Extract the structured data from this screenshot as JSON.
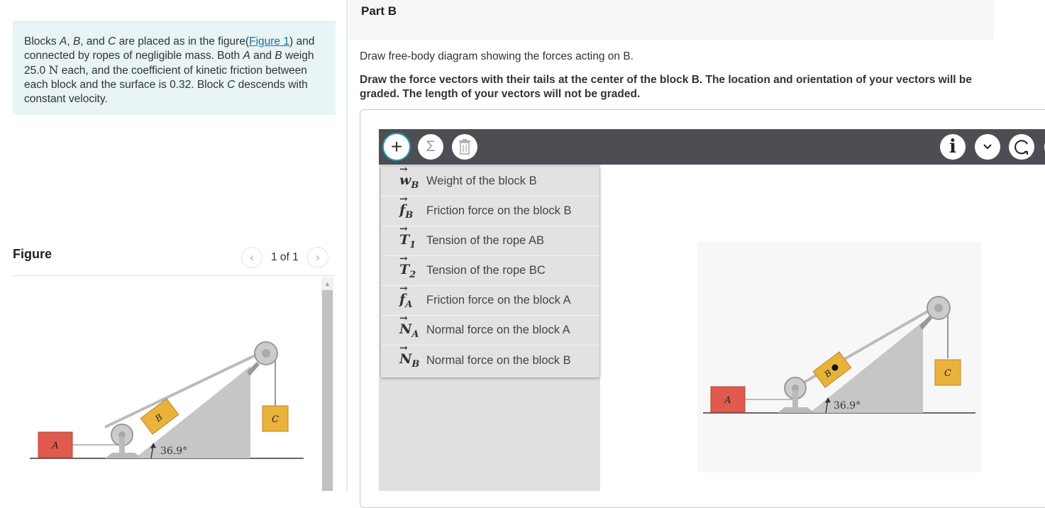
{
  "problem": {
    "text_before_link": "Blocks ",
    "A": "A",
    "comma1": ", ",
    "B": "B",
    "and": ", and ",
    "C": "C",
    "placed": " are placed as in the figure(",
    "link": "Figure 1",
    "after_link": ") and connected by ropes of negligible mass. Both ",
    "A2": "A",
    "and2": " and ",
    "B2": "B",
    "weigh": " weigh 25.0 ",
    "unitN": "N",
    "rest": " each, and the coefficient of kinetic friction between each block and the surface is 0.32. Block ",
    "C2": "C",
    "end": " descends with constant velocity."
  },
  "figure": {
    "title": "Figure",
    "pager_text": "1 of 1",
    "angle_label": "36.9°",
    "block_a": "A",
    "block_b": "B",
    "block_c": "C"
  },
  "part": {
    "title": "Part B",
    "instruction": "Draw free-body diagram showing the forces acting on B.",
    "instruction_bold": "Draw the force vectors with their tails at the center of the block B. The location and orientation of your vectors will be graded. The length of your vectors will not be graded."
  },
  "toolbar": {
    "icons": [
      "plus-icon",
      "sigma-icon",
      "trash-icon",
      "info-icon",
      "chevron-down-icon",
      "reset-icon"
    ]
  },
  "vectors": [
    {
      "symbol": "w",
      "sub": "B",
      "label": "Weight of the block B"
    },
    {
      "symbol": "f",
      "sub": "B",
      "label": "Friction force on the block B"
    },
    {
      "symbol": "T",
      "sub": "1",
      "label": "Tension of the rope AB"
    },
    {
      "symbol": "T",
      "sub": "2",
      "label": "Tension of the rope BC"
    },
    {
      "symbol": "f",
      "sub": "A",
      "label": "Friction force on the block A"
    },
    {
      "symbol": "N",
      "sub": "A",
      "label": "Normal force on the block A"
    },
    {
      "symbol": "N",
      "sub": "B",
      "label": "Normal force on the block B"
    }
  ],
  "colors": {
    "block_a": "#e05a4e",
    "block_bc": "#e9b23b",
    "incline": "#c6c6c6",
    "accent": "#1aa0a8"
  }
}
